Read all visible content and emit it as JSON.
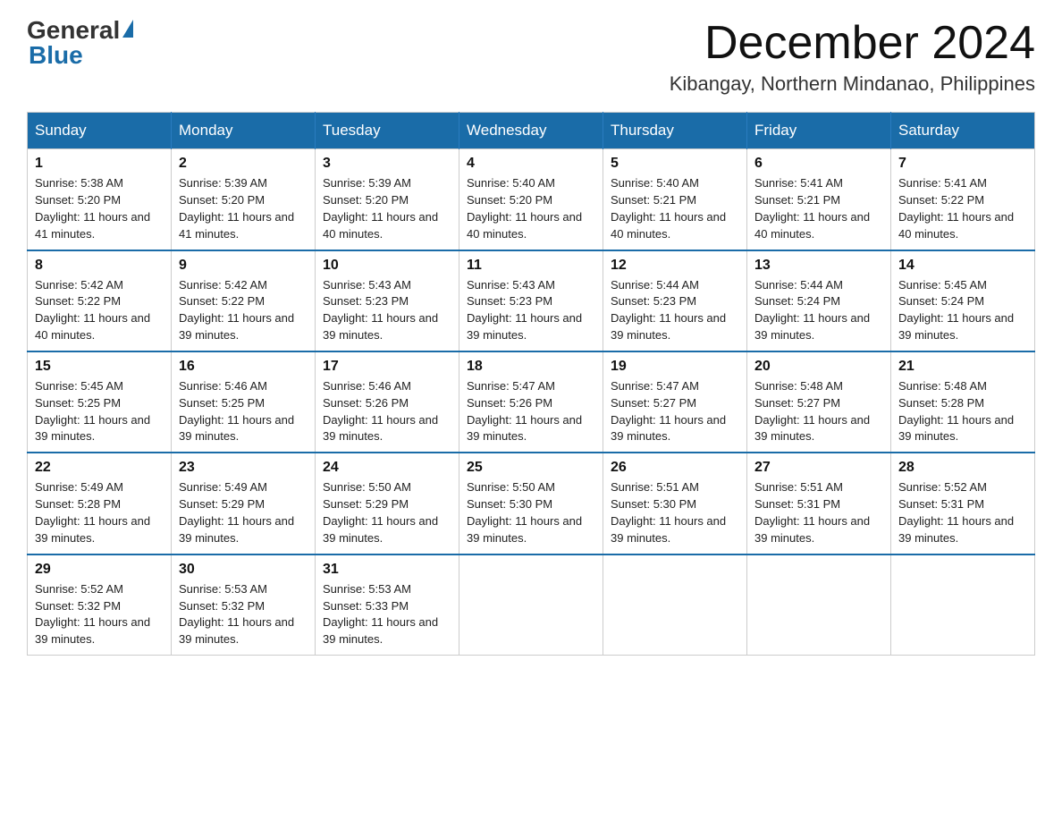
{
  "logo": {
    "general": "General",
    "blue": "Blue"
  },
  "title": "December 2024",
  "location": "Kibangay, Northern Mindanao, Philippines",
  "days_header": [
    "Sunday",
    "Monday",
    "Tuesday",
    "Wednesday",
    "Thursday",
    "Friday",
    "Saturday"
  ],
  "weeks": [
    [
      {
        "num": "1",
        "sunrise": "5:38 AM",
        "sunset": "5:20 PM",
        "daylight": "11 hours and 41 minutes."
      },
      {
        "num": "2",
        "sunrise": "5:39 AM",
        "sunset": "5:20 PM",
        "daylight": "11 hours and 41 minutes."
      },
      {
        "num": "3",
        "sunrise": "5:39 AM",
        "sunset": "5:20 PM",
        "daylight": "11 hours and 40 minutes."
      },
      {
        "num": "4",
        "sunrise": "5:40 AM",
        "sunset": "5:20 PM",
        "daylight": "11 hours and 40 minutes."
      },
      {
        "num": "5",
        "sunrise": "5:40 AM",
        "sunset": "5:21 PM",
        "daylight": "11 hours and 40 minutes."
      },
      {
        "num": "6",
        "sunrise": "5:41 AM",
        "sunset": "5:21 PM",
        "daylight": "11 hours and 40 minutes."
      },
      {
        "num": "7",
        "sunrise": "5:41 AM",
        "sunset": "5:22 PM",
        "daylight": "11 hours and 40 minutes."
      }
    ],
    [
      {
        "num": "8",
        "sunrise": "5:42 AM",
        "sunset": "5:22 PM",
        "daylight": "11 hours and 40 minutes."
      },
      {
        "num": "9",
        "sunrise": "5:42 AM",
        "sunset": "5:22 PM",
        "daylight": "11 hours and 39 minutes."
      },
      {
        "num": "10",
        "sunrise": "5:43 AM",
        "sunset": "5:23 PM",
        "daylight": "11 hours and 39 minutes."
      },
      {
        "num": "11",
        "sunrise": "5:43 AM",
        "sunset": "5:23 PM",
        "daylight": "11 hours and 39 minutes."
      },
      {
        "num": "12",
        "sunrise": "5:44 AM",
        "sunset": "5:23 PM",
        "daylight": "11 hours and 39 minutes."
      },
      {
        "num": "13",
        "sunrise": "5:44 AM",
        "sunset": "5:24 PM",
        "daylight": "11 hours and 39 minutes."
      },
      {
        "num": "14",
        "sunrise": "5:45 AM",
        "sunset": "5:24 PM",
        "daylight": "11 hours and 39 minutes."
      }
    ],
    [
      {
        "num": "15",
        "sunrise": "5:45 AM",
        "sunset": "5:25 PM",
        "daylight": "11 hours and 39 minutes."
      },
      {
        "num": "16",
        "sunrise": "5:46 AM",
        "sunset": "5:25 PM",
        "daylight": "11 hours and 39 minutes."
      },
      {
        "num": "17",
        "sunrise": "5:46 AM",
        "sunset": "5:26 PM",
        "daylight": "11 hours and 39 minutes."
      },
      {
        "num": "18",
        "sunrise": "5:47 AM",
        "sunset": "5:26 PM",
        "daylight": "11 hours and 39 minutes."
      },
      {
        "num": "19",
        "sunrise": "5:47 AM",
        "sunset": "5:27 PM",
        "daylight": "11 hours and 39 minutes."
      },
      {
        "num": "20",
        "sunrise": "5:48 AM",
        "sunset": "5:27 PM",
        "daylight": "11 hours and 39 minutes."
      },
      {
        "num": "21",
        "sunrise": "5:48 AM",
        "sunset": "5:28 PM",
        "daylight": "11 hours and 39 minutes."
      }
    ],
    [
      {
        "num": "22",
        "sunrise": "5:49 AM",
        "sunset": "5:28 PM",
        "daylight": "11 hours and 39 minutes."
      },
      {
        "num": "23",
        "sunrise": "5:49 AM",
        "sunset": "5:29 PM",
        "daylight": "11 hours and 39 minutes."
      },
      {
        "num": "24",
        "sunrise": "5:50 AM",
        "sunset": "5:29 PM",
        "daylight": "11 hours and 39 minutes."
      },
      {
        "num": "25",
        "sunrise": "5:50 AM",
        "sunset": "5:30 PM",
        "daylight": "11 hours and 39 minutes."
      },
      {
        "num": "26",
        "sunrise": "5:51 AM",
        "sunset": "5:30 PM",
        "daylight": "11 hours and 39 minutes."
      },
      {
        "num": "27",
        "sunrise": "5:51 AM",
        "sunset": "5:31 PM",
        "daylight": "11 hours and 39 minutes."
      },
      {
        "num": "28",
        "sunrise": "5:52 AM",
        "sunset": "5:31 PM",
        "daylight": "11 hours and 39 minutes."
      }
    ],
    [
      {
        "num": "29",
        "sunrise": "5:52 AM",
        "sunset": "5:32 PM",
        "daylight": "11 hours and 39 minutes."
      },
      {
        "num": "30",
        "sunrise": "5:53 AM",
        "sunset": "5:32 PM",
        "daylight": "11 hours and 39 minutes."
      },
      {
        "num": "31",
        "sunrise": "5:53 AM",
        "sunset": "5:33 PM",
        "daylight": "11 hours and 39 minutes."
      },
      null,
      null,
      null,
      null
    ]
  ],
  "labels": {
    "sunrise": "Sunrise: ",
    "sunset": "Sunset: ",
    "daylight": "Daylight: "
  }
}
